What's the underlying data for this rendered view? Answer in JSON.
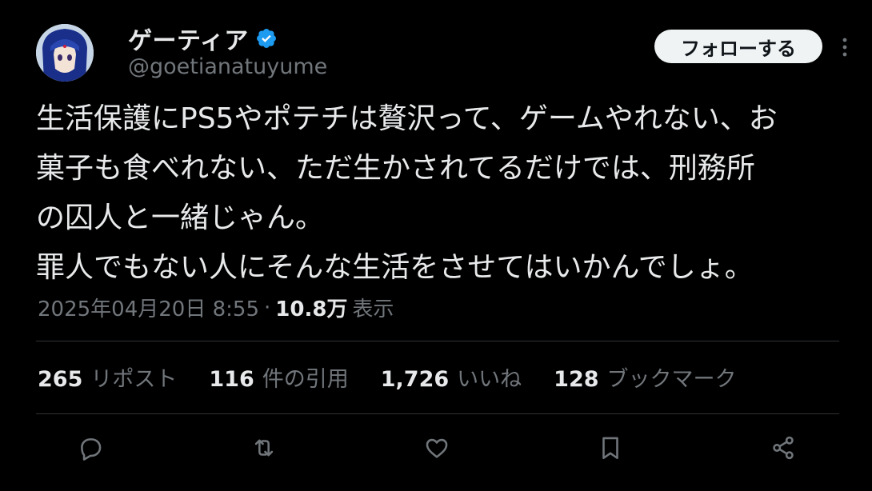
{
  "author": {
    "display_name": "ゲーティア",
    "handle": "@goetianatuyume",
    "verified": true
  },
  "follow_button": "フォローする",
  "tweet": {
    "text": "生活保護にPS5やポテチは贅沢って、ゲームやれない、お\n菓子も食べれない、ただ生かされてるだけでは、刑務所\nの囚人と一緒じゃん。\n罪人でもない人にそんな生活をさせてはいかんでしょ。"
  },
  "meta": {
    "timestamp": "2025年04月20日 8:55",
    "separator": "·",
    "views_count": "10.8万",
    "views_label": "表示"
  },
  "stats": {
    "reposts": {
      "count": "265",
      "label": "リポスト"
    },
    "quotes": {
      "count": "116",
      "label": "件の引用"
    },
    "likes": {
      "count": "1,726",
      "label": "いいね"
    },
    "bookmarks": {
      "count": "128",
      "label": "ブックマーク"
    }
  },
  "colors": {
    "background": "#000000",
    "text_primary": "#e7e9ea",
    "text_secondary": "#71767b",
    "verified_blue": "#1d9bf0",
    "divider": "#2f3336"
  },
  "icons": [
    "verified-badge-icon",
    "more-options-icon",
    "reply-icon",
    "repost-icon",
    "like-icon",
    "bookmark-icon",
    "share-icon"
  ]
}
